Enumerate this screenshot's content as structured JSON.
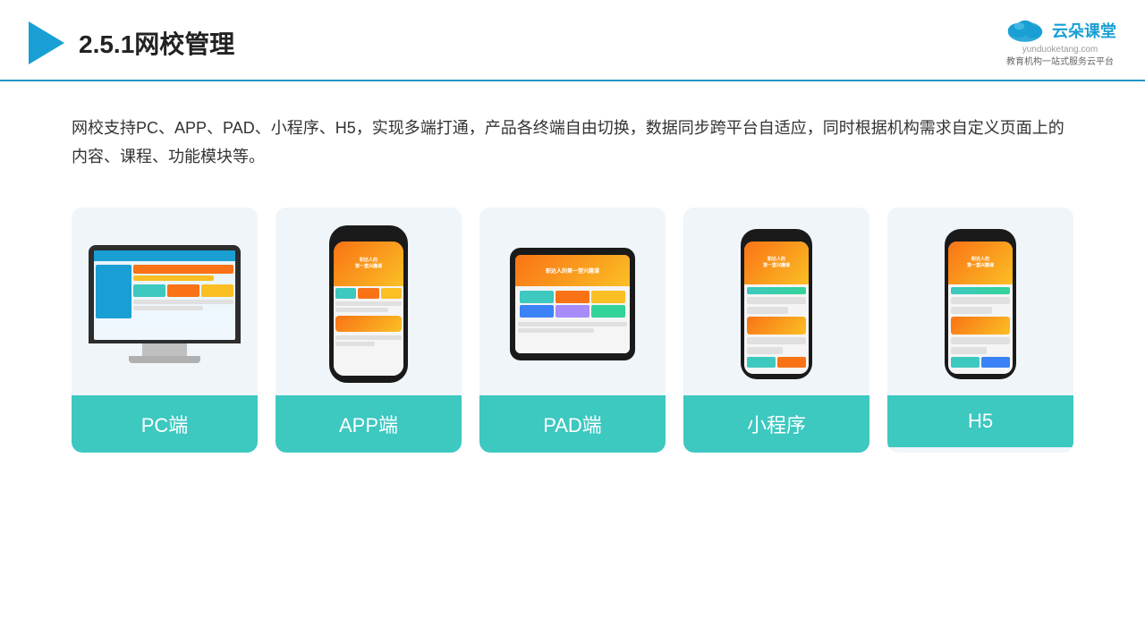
{
  "header": {
    "title": "2.5.1网校管理",
    "logo": {
      "name": "云朵课堂",
      "url": "yunduoketang.com",
      "tagline": "教育机构一站\n式服务云平台"
    }
  },
  "description": "网校支持PC、APP、PAD、小程序、H5，实现多端打通，产品各终端自由切换，数据同步跨平台自适应，同时根据机构需求自定义页面上的内容、课程、功能模块等。",
  "cards": [
    {
      "id": "pc",
      "label": "PC端",
      "type": "monitor"
    },
    {
      "id": "app",
      "label": "APP端",
      "type": "phone"
    },
    {
      "id": "pad",
      "label": "PAD端",
      "type": "tablet"
    },
    {
      "id": "miniprogram",
      "label": "小程序",
      "type": "miniphone"
    },
    {
      "id": "h5",
      "label": "H5",
      "type": "miniphone2"
    }
  ],
  "colors": {
    "accent": "#1a9fd4",
    "teal": "#3dc8c0",
    "border": "#2196c4"
  }
}
